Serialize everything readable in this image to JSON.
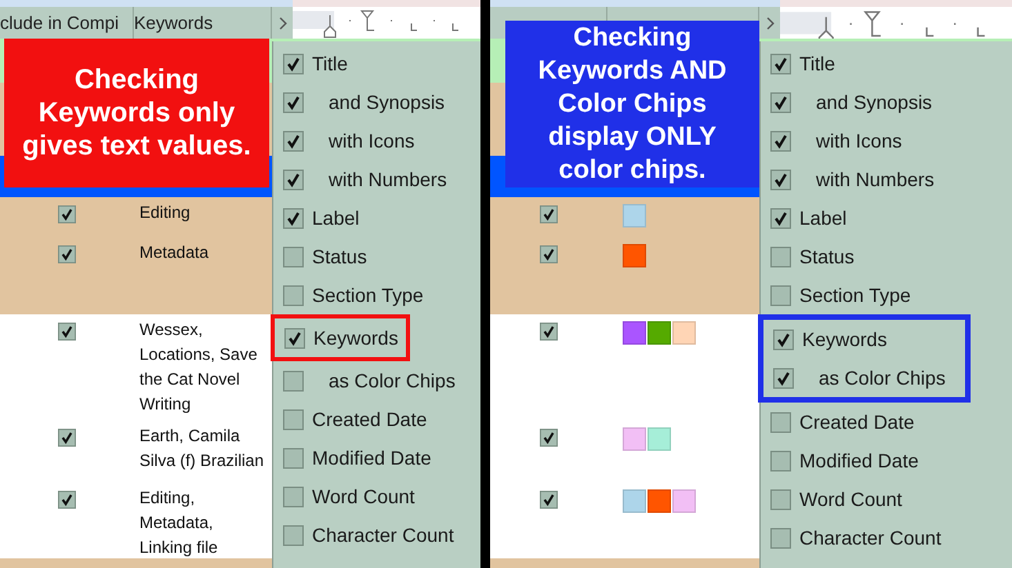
{
  "panels": [
    {
      "callout": {
        "text": "Checking Keywords only gives text values.",
        "color": "#f21010"
      },
      "columns": [
        "clude in Compi",
        "Keywords"
      ],
      "rows": [
        {
          "color": "#b6efb6"
        },
        {
          "color": "#e1c49f"
        },
        {
          "color": "#0055ff"
        },
        {
          "color": "#e1c49f",
          "included": true,
          "kind": "text",
          "keywords": "Editing"
        },
        {
          "color": "#e1c49f",
          "included": true,
          "kind": "text",
          "keywords": "Metadata"
        },
        {
          "color": "#e1c49f"
        },
        {
          "color": "#ffffff",
          "included": true,
          "kind": "text",
          "keywords": "Wessex, Locations, Save the Cat Novel Writing"
        },
        {
          "color": "#ffffff",
          "included": true,
          "kind": "text",
          "keywords": "Earth, Camila Silva (f) Brazilian"
        },
        {
          "color": "#ffffff",
          "included": true,
          "kind": "text",
          "keywords": "Editing, Metadata, Linking file"
        },
        {
          "color": "#e1c49f"
        }
      ],
      "menu": [
        {
          "label": "Title",
          "checked": true,
          "indented": false,
          "highlighted": false
        },
        {
          "label": "and Synopsis",
          "checked": true,
          "indented": true,
          "highlighted": false
        },
        {
          "label": "with Icons",
          "checked": true,
          "indented": true,
          "highlighted": false
        },
        {
          "label": "with Numbers",
          "checked": true,
          "indented": true,
          "highlighted": false
        },
        {
          "label": "Label",
          "checked": true,
          "indented": false,
          "highlighted": false
        },
        {
          "label": "Status",
          "checked": false,
          "indented": false,
          "highlighted": false
        },
        {
          "label": "Section Type",
          "checked": false,
          "indented": false,
          "highlighted": false
        },
        {
          "label": "Keywords",
          "checked": true,
          "indented": false,
          "highlighted": true
        },
        {
          "label": "as Color Chips",
          "checked": false,
          "indented": true,
          "highlighted": false
        },
        {
          "label": "Created Date",
          "checked": false,
          "indented": false,
          "highlighted": false
        },
        {
          "label": "Modified Date",
          "checked": false,
          "indented": false,
          "highlighted": false
        },
        {
          "label": "Word Count",
          "checked": false,
          "indented": false,
          "highlighted": false
        },
        {
          "label": "Character Count",
          "checked": false,
          "indented": false,
          "highlighted": false
        }
      ]
    },
    {
      "callout": {
        "text": "Checking Keywords AND Color Chips display ONLY color chips.",
        "color": "#2030e8"
      },
      "rows": [
        {
          "color": "#b6efb6"
        },
        {
          "color": "#e1c49f"
        },
        {
          "color": "#0055ff"
        },
        {
          "color": "#e1c49f",
          "included": true,
          "kind": "chips",
          "chips": [
            {
              "color": "#add5ea"
            }
          ]
        },
        {
          "color": "#e1c49f",
          "included": true,
          "kind": "chips",
          "chips": [
            {
              "color": "#ff5500"
            }
          ]
        },
        {
          "color": "#e1c49f"
        },
        {
          "color": "#ffffff",
          "included": true,
          "kind": "chips",
          "chips": [
            {
              "color": "#aa55ff"
            },
            {
              "color": "#55aa00"
            },
            {
              "color": "#ffd5b5"
            }
          ]
        },
        {
          "color": "#ffffff",
          "included": true,
          "kind": "chips",
          "chips": [
            {
              "color": "#f2bff5"
            },
            {
              "color": "#a6eed8"
            }
          ]
        },
        {
          "color": "#ffffff",
          "included": true,
          "kind": "chips",
          "chips": [
            {
              "color": "#add5ea"
            },
            {
              "color": "#ff5500"
            },
            {
              "color": "#f2bff5"
            }
          ]
        },
        {
          "color": "#e1c49f"
        }
      ],
      "menu": [
        {
          "label": "Title",
          "checked": true,
          "indented": false,
          "highlighted": false
        },
        {
          "label": "and Synopsis",
          "checked": true,
          "indented": true,
          "highlighted": false
        },
        {
          "label": "with Icons",
          "checked": true,
          "indented": true,
          "highlighted": false
        },
        {
          "label": "with Numbers",
          "checked": true,
          "indented": true,
          "highlighted": false
        },
        {
          "label": "Label",
          "checked": true,
          "indented": false,
          "highlighted": false
        },
        {
          "label": "Status",
          "checked": false,
          "indented": false,
          "highlighted": false
        },
        {
          "label": "Section Type",
          "checked": false,
          "indented": false,
          "highlighted": false
        },
        {
          "label": "Keywords",
          "checked": true,
          "indented": false,
          "highlighted": true
        },
        {
          "label": "as Color Chips",
          "checked": true,
          "indented": true,
          "highlighted": true
        },
        {
          "label": "Created Date",
          "checked": false,
          "indented": false,
          "highlighted": false
        },
        {
          "label": "Modified Date",
          "checked": false,
          "indented": false,
          "highlighted": false
        },
        {
          "label": "Word Count",
          "checked": false,
          "indented": false,
          "highlighted": false
        },
        {
          "label": "Character Count",
          "checked": false,
          "indented": false,
          "highlighted": false
        }
      ]
    }
  ]
}
